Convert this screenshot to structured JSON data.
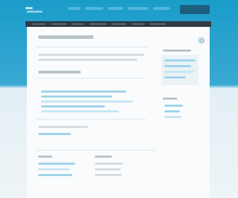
{
  "header": {
    "logo_icon": "logo-icon",
    "nav_items": [
      "",
      "",
      "",
      "",
      ""
    ],
    "action_button_label": ""
  },
  "search": {
    "icon": "search-icon"
  },
  "colors": {
    "header_blue": "#1a9cc9",
    "navbar": "#2e3b43",
    "button": "#1a5f7e",
    "link_blue": "#9ed3ea",
    "content_bg": "#f9fbfc"
  }
}
